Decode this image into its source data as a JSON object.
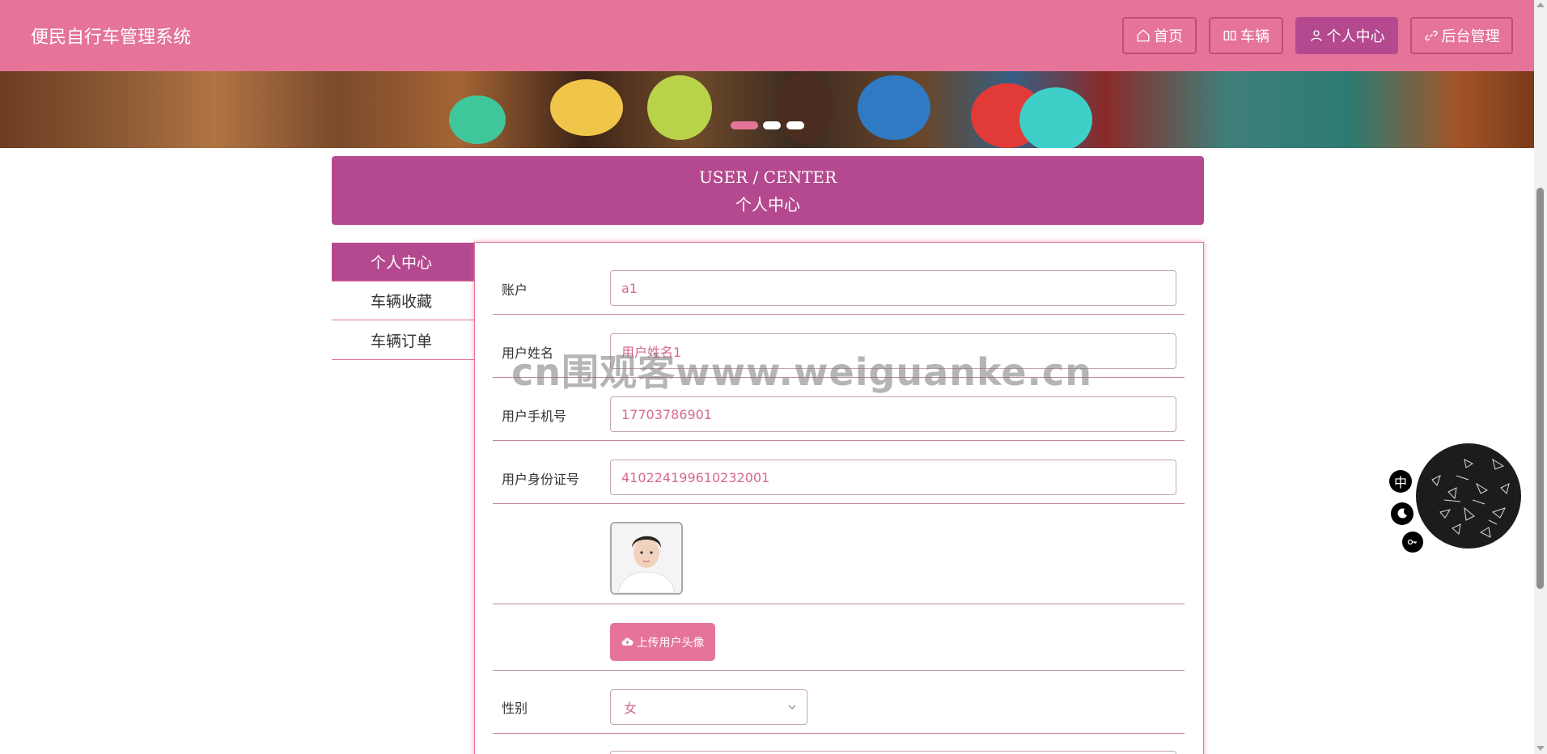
{
  "header": {
    "brand": "便民自行车管理系统",
    "nav": [
      {
        "label": "首页",
        "icon": "home-icon"
      },
      {
        "label": "车辆",
        "icon": "grid-icon"
      },
      {
        "label": "个人中心",
        "icon": "user-icon",
        "active": true
      },
      {
        "label": "后台管理",
        "icon": "link-icon"
      }
    ]
  },
  "banner": {
    "slides": 3,
    "active_slide": 1
  },
  "page_title": {
    "en": "USER / CENTER",
    "zh": "个人中心"
  },
  "sidebar": {
    "items": [
      {
        "label": "个人中心",
        "active": true
      },
      {
        "label": "车辆收藏",
        "active": false
      },
      {
        "label": "车辆订单",
        "active": false
      }
    ]
  },
  "form": {
    "account": {
      "label": "账户",
      "value": "a1"
    },
    "name": {
      "label": "用户姓名",
      "value": "用户姓名1"
    },
    "phone": {
      "label": "用户手机号",
      "value": "17703786901"
    },
    "id_card": {
      "label": "用户身份证号",
      "value": "410224199610232001"
    },
    "upload_label": "上传用户头像",
    "gender": {
      "label": "性别",
      "value": "女"
    }
  },
  "watermark": "cn围观客www.weiguanke.cn",
  "widget": {
    "lang": "中",
    "theme_icon": "moon-icon",
    "key_icon": "key-icon"
  },
  "colors": {
    "primary": "#e57498",
    "accent": "#b4498f",
    "text": "#333333"
  }
}
